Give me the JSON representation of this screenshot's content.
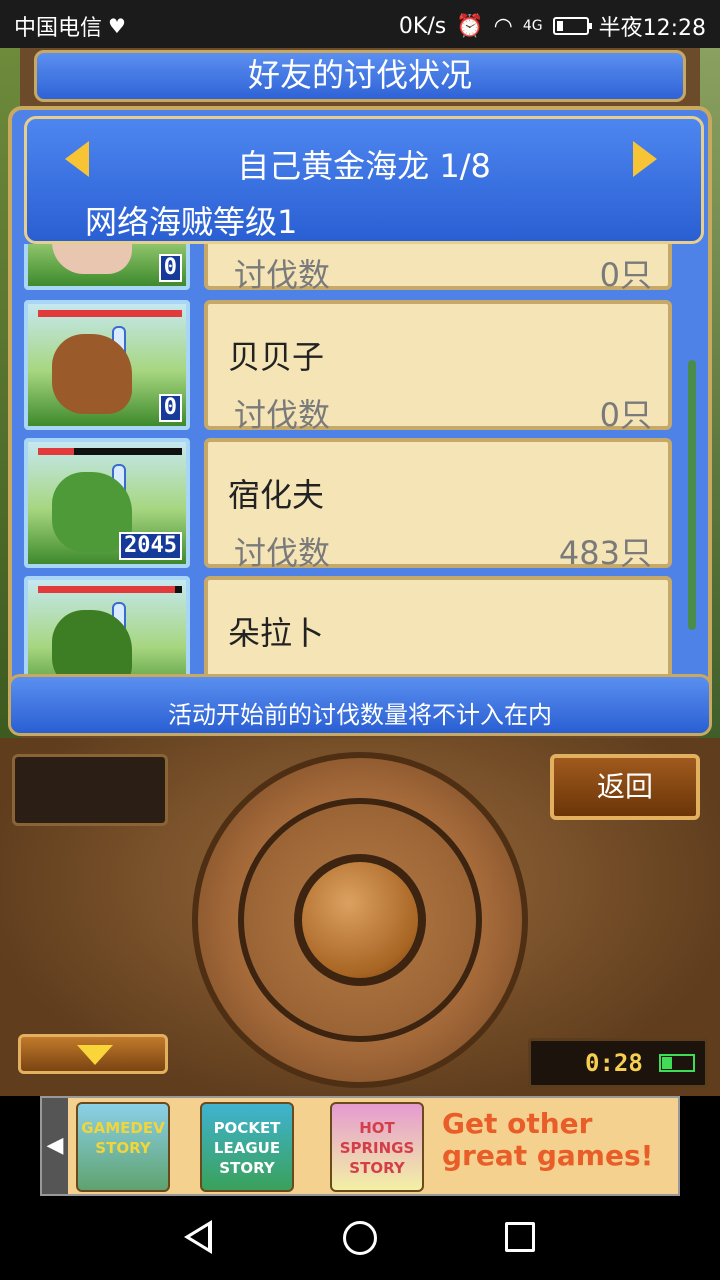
{
  "status_bar": {
    "carrier": "中国电信",
    "net_speed": "0K/s",
    "network": "4G",
    "time": "半夜12:28"
  },
  "screen": {
    "title": "好友的讨伐状况",
    "friend_island": "自己黄金海龙 1/8",
    "pirate_level": "网络海贼等级1"
  },
  "monsters": [
    {
      "name": "",
      "kill_label": "讨伐数",
      "kill_value": "0只",
      "badge": "0",
      "hp": 1.0,
      "color": "#e9c6b0"
    },
    {
      "name": "贝贝子",
      "kill_label": "讨伐数",
      "kill_value": "0只",
      "badge": "0",
      "hp": 1.0,
      "color": "#9a5a2a"
    },
    {
      "name": "宿化夫",
      "kill_label": "讨伐数",
      "kill_value": "483只",
      "badge": "2045",
      "hp": 0.25,
      "color": "#4f9a38"
    },
    {
      "name": "朵拉卜",
      "kill_label": "",
      "kill_value": "",
      "badge": "",
      "hp": 0.95,
      "color": "#3d7e24"
    }
  ],
  "notice": "活动开始前的讨伐数量将不计入在内",
  "controller": {
    "back_label": "返回",
    "timer": "0:28"
  },
  "ad": {
    "games": [
      "GAMEDEV STORY",
      "POCKET LEAGUE STORY",
      "HOT SPRINGS STORY"
    ],
    "slogan": "Get other great games!"
  }
}
